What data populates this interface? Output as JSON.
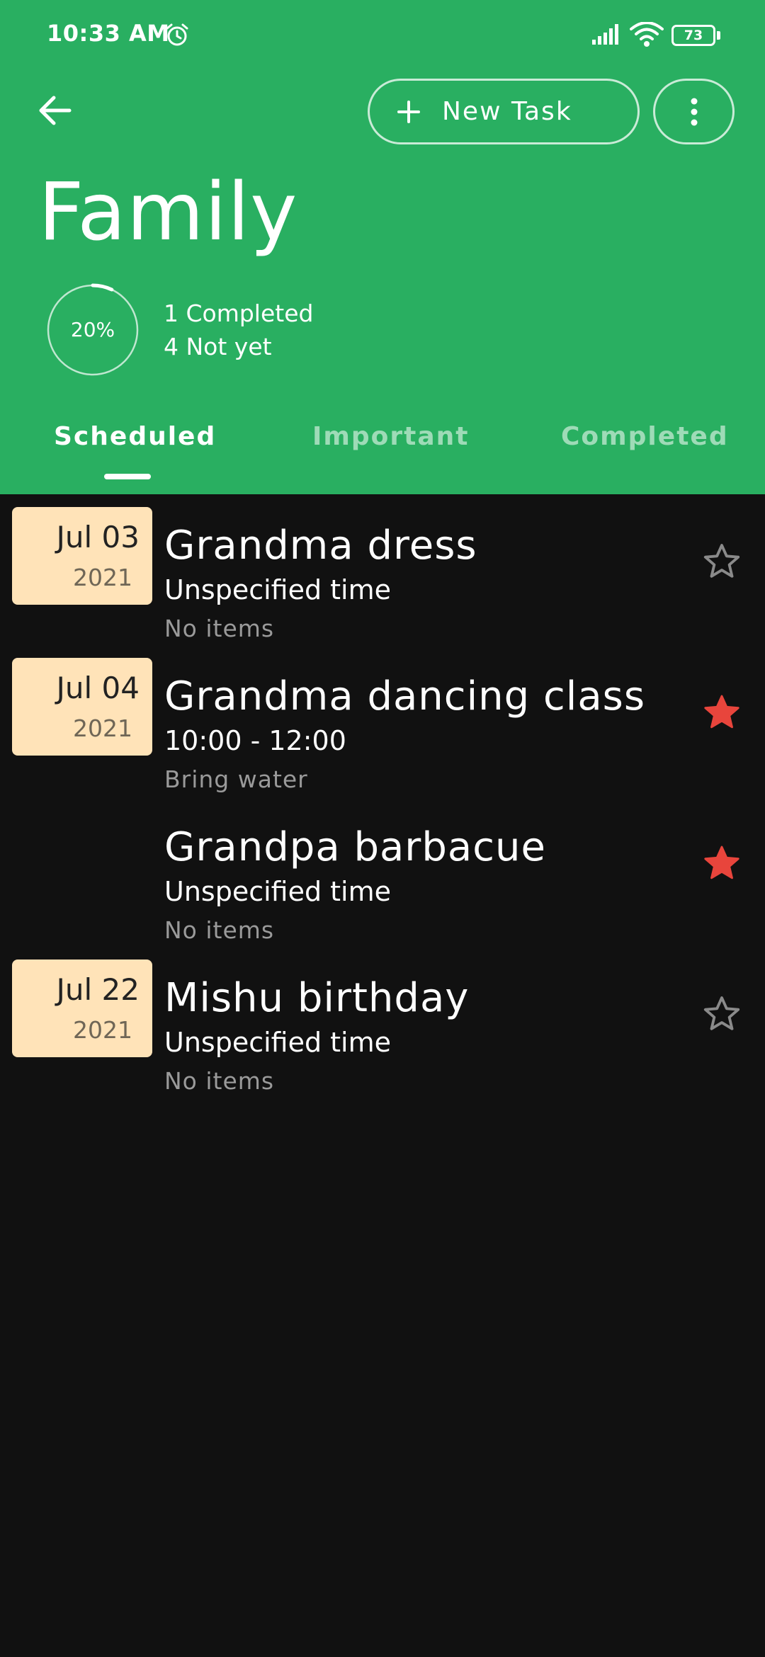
{
  "status_bar": {
    "time": "10:33 AM",
    "battery": "73"
  },
  "header": {
    "new_task_label": "New Task",
    "title": "Family",
    "progress_percent": 20,
    "progress_label": "20%",
    "completed_text": "1 Completed",
    "not_yet_text": "4 Not yet"
  },
  "tabs": [
    {
      "label": "Scheduled",
      "active": true
    },
    {
      "label": "Important",
      "active": false
    },
    {
      "label": "Completed",
      "active": false
    }
  ],
  "tasks": [
    {
      "date_md": "Jul 03",
      "date_year": "2021",
      "title": "Grandma dress",
      "time": "Unspecified time",
      "note": "No items",
      "starred": false
    },
    {
      "date_md": "Jul 04",
      "date_year": "2021",
      "title": "Grandma dancing class",
      "time": "10:00 - 12:00",
      "note": "Bring water",
      "starred": true
    },
    {
      "date_md": "",
      "date_year": "",
      "title": "Grandpa barbacue",
      "time": "Unspecified time",
      "note": "No items",
      "starred": true
    },
    {
      "date_md": "Jul 22",
      "date_year": "2021",
      "title": "Mishu birthday",
      "time": "Unspecified time",
      "note": "No items",
      "starred": false
    }
  ],
  "colors": {
    "header_bg": "#29af61",
    "body_bg": "#111111",
    "date_badge_bg": "#ffe3b8",
    "star_active": "#e8453c",
    "star_inactive": "#8a8a8a"
  },
  "icons": [
    "alarm-icon",
    "signal-icon",
    "wifi-icon",
    "battery-icon",
    "back-arrow-icon",
    "plus-icon",
    "more-vert-icon",
    "star-icon"
  ]
}
